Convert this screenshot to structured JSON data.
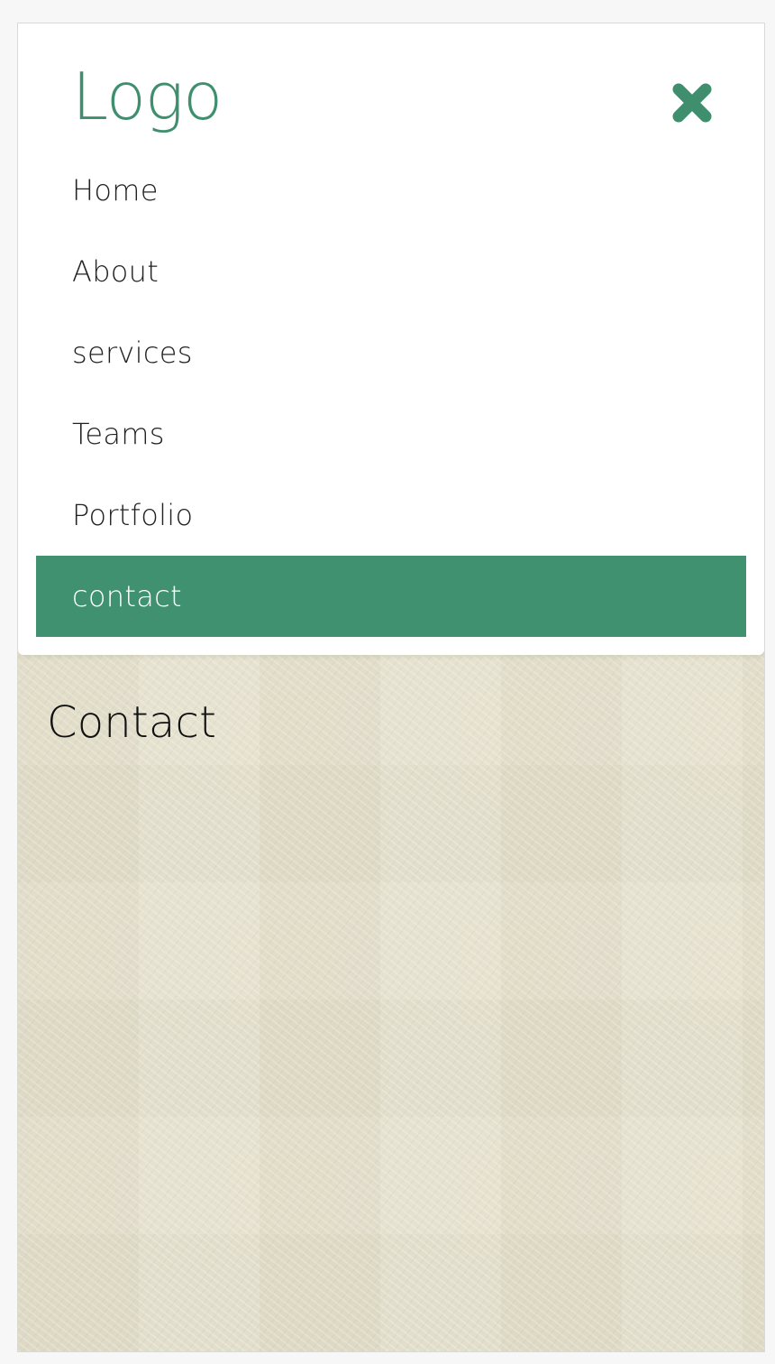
{
  "header": {
    "logo_text": "Logo",
    "close_icon": "close-x-icon"
  },
  "nav": {
    "items": [
      {
        "label": "Home",
        "active": false
      },
      {
        "label": "About",
        "active": false
      },
      {
        "label": "services",
        "active": false
      },
      {
        "label": "Teams",
        "active": false
      },
      {
        "label": "Portfolio",
        "active": false
      },
      {
        "label": "contact",
        "active": true
      }
    ]
  },
  "main": {
    "heading": "Contact"
  },
  "colors": {
    "brand": "#3f8f6f",
    "active_background": "#3f9170",
    "active_text": "#ffffff",
    "nav_text": "#222222",
    "page_background": "#e4e0cd"
  }
}
